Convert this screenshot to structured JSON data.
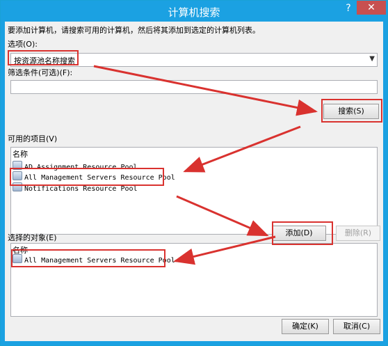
{
  "window": {
    "title": "计算机搜索",
    "help_icon": "?",
    "close_icon": "✕"
  },
  "instructions": "要添加计算机，请搜索可用的计算机，然后将其添加到选定的计算机列表。",
  "options": {
    "label": "选项(O):",
    "selected": "按资源池名称搜索",
    "dropdown_icon": "chevron-down-icon"
  },
  "filter": {
    "label": "筛选条件(可选)(F):",
    "value": ""
  },
  "search_button": "搜索(S)",
  "available": {
    "label": "可用的项目(V)",
    "header": "名称",
    "items": [
      "AD Assignment Resource Pool",
      "All Management Servers Resource Pool",
      "Notifications Resource Pool"
    ]
  },
  "add_button": "添加(D)",
  "remove_button": "删除(R)",
  "selected": {
    "label": "选择的对象(E)",
    "header": "名称",
    "items": [
      "All Management Servers Resource Pool"
    ]
  },
  "ok_button": "确定(K)",
  "cancel_button": "取消(C)",
  "colors": {
    "title_bar": "#1ba1e2",
    "annotation": "#d9322f",
    "close": "#c75050"
  }
}
